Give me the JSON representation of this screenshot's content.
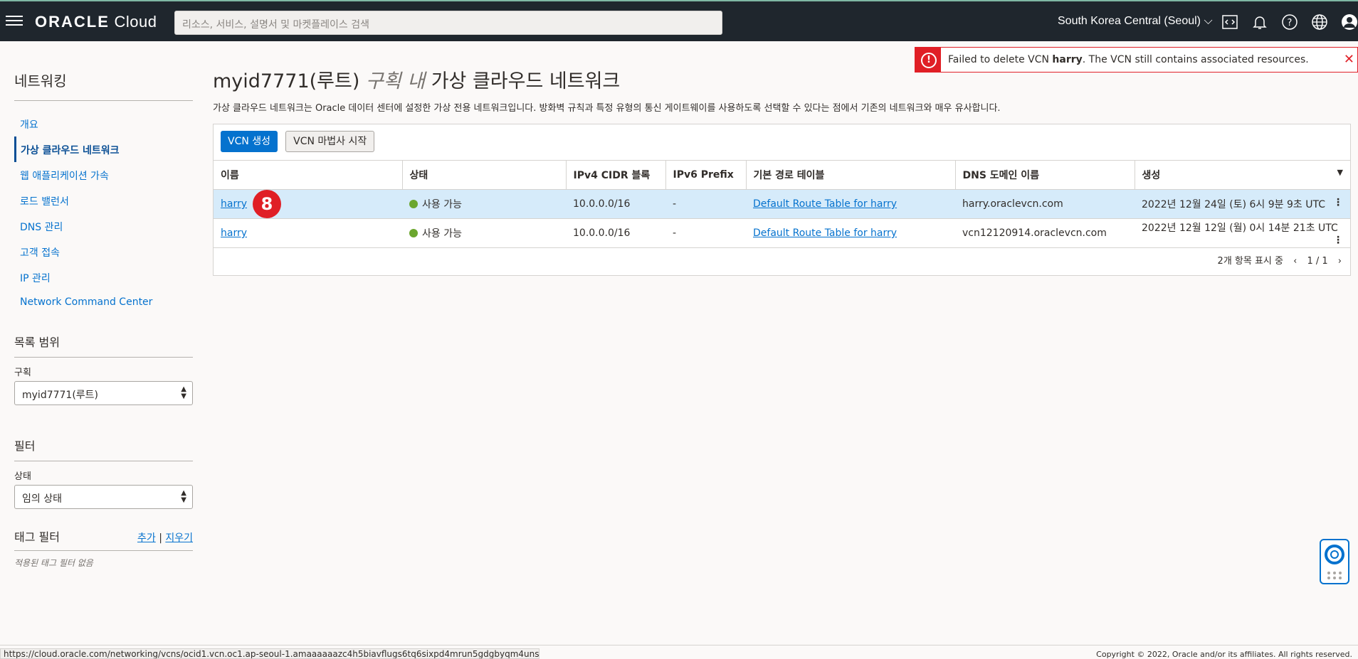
{
  "topbar": {
    "logo_bold": "ORACLE",
    "logo_light": "Cloud",
    "search_placeholder": "리소스, 서비스, 설명서 및 마켓플레이스 검색",
    "region": "South Korea Central (Seoul)"
  },
  "toast": {
    "prefix": "Failed to delete VCN ",
    "vcn": "harry",
    "suffix": ". The VCN still contains associated resources."
  },
  "sidebar": {
    "title": "네트워킹",
    "items": [
      {
        "label": "개요"
      },
      {
        "label": "가상 클라우드 네트워크"
      },
      {
        "label": "웹 애플리케이션 가속"
      },
      {
        "label": "로드 밸런서"
      },
      {
        "label": "DNS 관리"
      },
      {
        "label": "고객 접속"
      },
      {
        "label": "IP 관리"
      },
      {
        "label": "Network Command Center"
      }
    ],
    "scope_title": "목록 범위",
    "compartment_label": "구획",
    "compartment_value": "myid7771(루트)",
    "filter_title": "필터",
    "state_label": "상태",
    "state_value": "임의 상태",
    "tag_filter_title": "태그 필터",
    "tag_add": "추가",
    "tag_sep": "|",
    "tag_clear": "지우기",
    "tag_none": "적용된 태그 필터 없음"
  },
  "main": {
    "title_prefix": "myid7771(루트)",
    "title_ital": "구획 내",
    "title_suffix": "가상 클라우드 네트워크",
    "description": "가상 클라우드 네트워크는 Oracle 데이터 센터에 설정한 가상 전용 네트워크입니다. 방화벽 규칙과 특정 유형의 통신 게이트웨이를 사용하도록 선택할 수 있다는 점에서 기존의 네트워크와 매우 유사합니다.",
    "create_button": "VCN 생성",
    "wizard_button": "VCN 마법사 시작",
    "columns": [
      "이름",
      "상태",
      "IPv4 CIDR 블록",
      "IPv6 Prefix",
      "기본 경로 테이블",
      "DNS 도메인 이름",
      "생성"
    ],
    "rows": [
      {
        "name": "harry",
        "state": "사용 가능",
        "cidr": "10.0.0.0/16",
        "ipv6": "-",
        "route": "Default Route Table for harry",
        "dns": "harry.oraclevcn.com",
        "created": "2022년 12월 24일 (토) 6시 9분 9초 UTC"
      },
      {
        "name": "harry",
        "state": "사용 가능",
        "cidr": "10.0.0.0/16",
        "ipv6": "-",
        "route": "Default Route Table for harry",
        "dns": "vcn12120914.oraclevcn.com",
        "created": "2022년 12월 12일 (월) 0시 14분 21초 UTC"
      }
    ],
    "step_badge": "8",
    "pager_count": "2개 항목 표시 중",
    "pager_page": "1 / 1"
  },
  "footer": {
    "status_url": "https://cloud.oracle.com/networking/vcns/ocid1.vcn.oc1.ap-seoul-1.amaaaaaazc4h5biavflugs6tq6sixpd4mrun5gdgbyqm4unsvy5wtkrdg4tq",
    "copyright": "Copyright © 2022, Oracle and/or its affiliates. All rights reserved."
  }
}
